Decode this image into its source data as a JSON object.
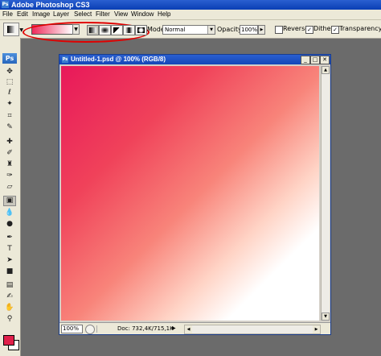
{
  "window": {
    "title": "Adobe Photoshop CS3",
    "app_icon": "Ps"
  },
  "menu": [
    "File",
    "Edit",
    "Image",
    "Layer",
    "Select",
    "Filter",
    "View",
    "Window",
    "Help"
  ],
  "options": {
    "mode_label": "Mode:",
    "mode_value": "Normal",
    "opacity_label": "Opacity:",
    "opacity_value": "100%",
    "reverse_label": "Reverse",
    "reverse_checked": false,
    "dither_label": "Dither",
    "dither_checked": true,
    "transparency_label": "Transparency",
    "transparency_checked": true,
    "gradient_colors": [
      "#ee2a5a",
      "#ffffff"
    ],
    "gradient_types": [
      "linear",
      "radial",
      "angle",
      "reflected",
      "diamond"
    ]
  },
  "toolbox": {
    "logo": "Ps",
    "tools": [
      "move-icon",
      "marquee-icon",
      "lasso-icon",
      "magic-wand-icon",
      "crop-icon",
      "slice-icon",
      "healing-brush-icon",
      "brush-icon",
      "clone-stamp-icon",
      "history-brush-icon",
      "eraser-icon",
      "gradient-icon",
      "blur-icon",
      "dodge-icon",
      "pen-icon",
      "type-icon",
      "path-selection-icon",
      "shape-icon",
      "notes-icon",
      "eyedropper-icon",
      "hand-icon",
      "zoom-icon"
    ],
    "foreground_color": "#e0204a",
    "background_color": "#ffffff"
  },
  "document": {
    "title": "Untitled-1.psd @ 100% (RGB/8)",
    "zoom": "100%",
    "doc_size": "Doc: 732,4K/715,1K",
    "gradient": {
      "start_color": "#e8185a",
      "end_color": "#ffffff",
      "direction": "top-left to bottom-right"
    }
  }
}
